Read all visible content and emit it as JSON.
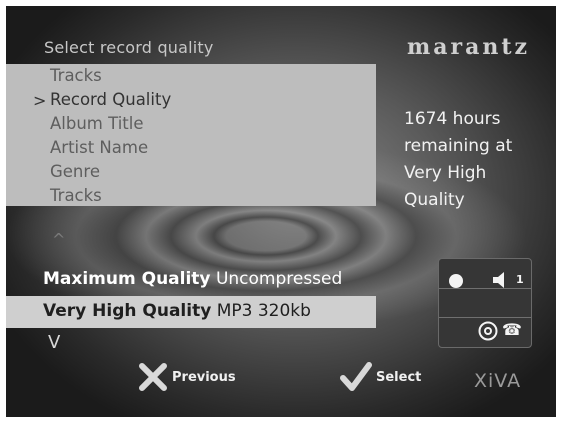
{
  "header": {
    "title": "Select record quality",
    "brand": "marantz"
  },
  "menu": {
    "caret": ">",
    "items": [
      {
        "label": "Tracks"
      },
      {
        "label": "Record Quality"
      },
      {
        "label": "Album Title"
      },
      {
        "label": "Artist Name"
      },
      {
        "label": "Genre"
      },
      {
        "label": "Tracks"
      }
    ],
    "selected_index": 1
  },
  "remaining": {
    "lines": [
      "1674 hours",
      "remaining at",
      "Very High",
      "Quality"
    ]
  },
  "quality_options": [
    {
      "name": "Maximum Quality",
      "detail": "Uncompressed",
      "selected": false
    },
    {
      "name": "Very High Quality",
      "detail": "MP3 320kb",
      "selected": true
    }
  ],
  "scroll": {
    "up_glyph": "^",
    "down_glyph": "V"
  },
  "status": {
    "record_icon": "record-dot-icon",
    "volume_icon": "speaker-icon",
    "volume_level": "1",
    "disc_icon": "disc-icon",
    "phone_icon": "phone-icon",
    "phone_glyph": "☎"
  },
  "footer": {
    "previous_label": "Previous",
    "previous_icon": "x-icon",
    "select_label": "Select",
    "select_icon": "check-icon",
    "brand": "XiVA"
  },
  "colors": {
    "highlight_row": "#cfcfcf",
    "menu_panel": "#bdbdbd",
    "text_light": "#f2f2f2"
  }
}
